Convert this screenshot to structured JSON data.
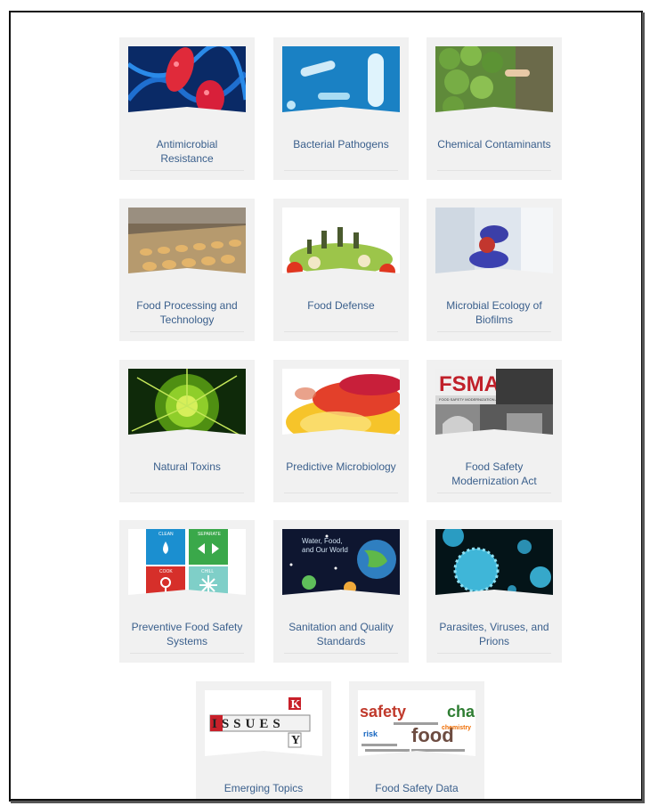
{
  "cards": [
    {
      "label": "Antimicrobial Resistance",
      "line1": "Antimicrobial",
      "line2": "Resistance",
      "icon": "red-bacteria-image"
    },
    {
      "label": "Bacterial Pathogens",
      "line1": "Bacterial Pathogens",
      "line2": "",
      "icon": "blue-bacteria-image"
    },
    {
      "label": "Chemical Contaminants",
      "line1": "Chemical Contaminants",
      "line2": "",
      "icon": "vegetables-inspection-image"
    },
    {
      "label": "Food Processing and Technology",
      "line1": "Food Processing and",
      "line2": "Technology",
      "icon": "conveyor-cookies-image"
    },
    {
      "label": "Food Defense",
      "line1": "Food Defense",
      "line2": "",
      "icon": "toy-soldiers-salad-image"
    },
    {
      "label": "Microbial Ecology of Biofilms",
      "line1": "Microbial Ecology of",
      "line2": "Biofilms",
      "icon": "lab-gloves-image"
    },
    {
      "label": "Natural Toxins",
      "line1": "Natural Toxins",
      "line2": "",
      "icon": "green-spores-image"
    },
    {
      "label": "Predictive Microbiology",
      "line1": "Predictive Microbiology",
      "line2": "",
      "icon": "petri-dish-image"
    },
    {
      "label": "Food Safety Modernization Act",
      "line1": "Food Safety",
      "line2": "Modernization Act",
      "icon": "fsma-collage-image"
    },
    {
      "label": "Preventive Food Safety Systems",
      "line1": "Preventive Food Safety",
      "line2": "Systems",
      "icon": "clean-separate-cook-chill-image"
    },
    {
      "label": "Sanitation and Quality Standards",
      "line1": "Sanitation and Quality",
      "line2": "Standards",
      "icon": "water-food-world-image"
    },
    {
      "label": "Parasites, Viruses, and Prions",
      "line1": "Parasites, Viruses, and",
      "line2": "Prions",
      "icon": "viruses-image"
    },
    {
      "label": "Emerging Topics",
      "line1": "Emerging Topics",
      "line2": "",
      "icon": "issues-tiles-image"
    },
    {
      "label": "Food Safety Data",
      "line1": "Food Safety Data",
      "line2": "",
      "icon": "word-cloud-image"
    }
  ],
  "thumb_text": {
    "fsma": "FSMA",
    "fsma_sub": "FOOD SAFETY MODERNIZATION ACT",
    "clean": "CLEAN",
    "separate": "SEPARATE",
    "cook": "COOK",
    "chill": "CHILL",
    "water_l1": "Water, Food,",
    "water_l2": "and Our World",
    "issues": "ISSUES",
    "key_k": "K",
    "key_e": "E",
    "key_y": "Y",
    "wc_safety": "safety",
    "wc_food": "food",
    "wc_cha": "cha",
    "wc_risk": "risk",
    "wc_chem": "chemistry"
  },
  "colors": {
    "card_bg": "#f1f1f1",
    "label": "#3a5f8c"
  }
}
